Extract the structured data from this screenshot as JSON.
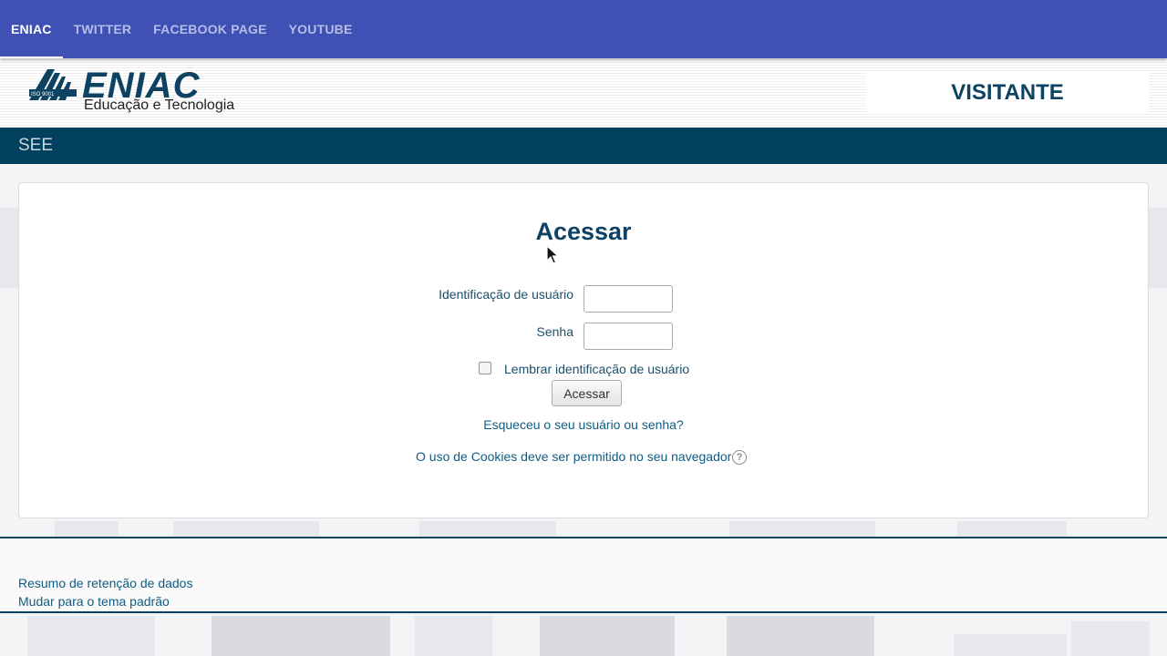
{
  "topnav": {
    "items": [
      {
        "label": "ENIAC",
        "active": true
      },
      {
        "label": "TWITTER",
        "active": false
      },
      {
        "label": "FACEBOOK PAGE",
        "active": false
      },
      {
        "label": "YOUTUBE",
        "active": false
      }
    ]
  },
  "header": {
    "logo_word": "ENIAC",
    "logo_sub": "Educação e Tecnologia",
    "logo_badge": "ISO 9001",
    "user_label": "VISITANTE"
  },
  "seebar": {
    "label": "SEE"
  },
  "login": {
    "title": "Acessar",
    "username_label": "Identificação de usuário",
    "username_value": "",
    "password_label": "Senha",
    "password_value": "",
    "remember_label": "Lembrar identificação de usuário",
    "remember_checked": false,
    "submit_label": "Acessar",
    "forgot_link": "Esqueceu o seu usuário ou senha?",
    "cookies_text": "O uso de Cookies deve ser permitido no seu navegador",
    "help_icon": "question-circle-icon"
  },
  "footer": {
    "links": [
      "Resumo de retenção de dados",
      "Mudar para o tema padrão"
    ]
  },
  "colors": {
    "nav_bg": "#3f51b5",
    "dark_teal": "#02405f",
    "brand": "#0d4262",
    "link": "#0f5c82"
  }
}
